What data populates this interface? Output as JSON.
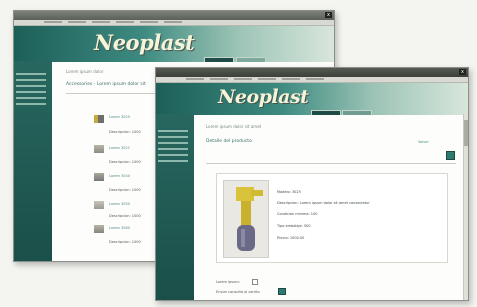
{
  "brand": {
    "logo_text": "Neoplast"
  },
  "back_window": {
    "crumb": "Lorem ipsum dolor",
    "page_title": "Accessories - Lorem ipsum dolor sit",
    "items": [
      {
        "link": "Lorem 3025",
        "text": "Descripcion: 1000"
      },
      {
        "link": "Lorem 3021",
        "text": "Descripcion: 1000"
      },
      {
        "link": "Lorem 3040",
        "text": "Descripcion: 1000"
      },
      {
        "link": "Lorem 3050",
        "text": "Descripcion: 1000"
      },
      {
        "link": "Lorem 3060",
        "text": "Descripcion: 1000"
      }
    ]
  },
  "front_window": {
    "crumb": "Lorem ipsum dolor sit amet",
    "page_title": "Detalle del producto",
    "action_link": "Volver",
    "specs": [
      "Modelo: 3025",
      "Descripcion: Lorem ipsum dolor sit amet consectetur",
      "Condicion minima: 100",
      "Tipo embalaje: 500",
      "Precio: 1000.00"
    ],
    "checkbox_label": "Lorem ipsum:",
    "submit_label": "Enviar consulta al carrito"
  },
  "colors": {
    "accent": "#2d7a70",
    "sidebar": "#1f5a53"
  }
}
